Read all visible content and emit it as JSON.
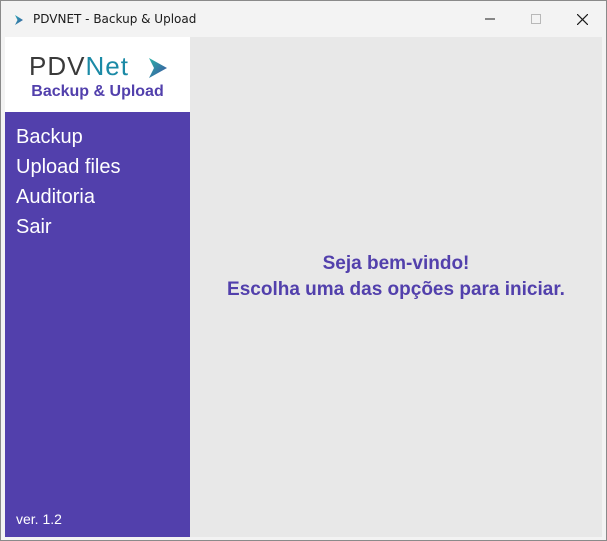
{
  "window": {
    "title": "PDVNET - Backup & Upload",
    "icon": "pdvnet-arrow-icon",
    "controls": [
      "minimize-icon",
      "maximize-icon",
      "close-icon"
    ]
  },
  "sidebar": {
    "logo": {
      "prefix": "PDV",
      "suffix": "Net",
      "subtitle": "Backup & Upload"
    },
    "items": [
      {
        "label": "Backup"
      },
      {
        "label": "Upload files"
      },
      {
        "label": "Auditoria"
      },
      {
        "label": "Sair"
      }
    ],
    "version": "ver. 1.2"
  },
  "main": {
    "welcome_line1": "Seja bem-vindo!",
    "welcome_line2": "Escolha uma das opções para iniciar."
  },
  "colors": {
    "accent": "#5240ac",
    "logo_teal": "#1b8aa6",
    "content_bg": "#e8e8e8",
    "text_white": "#ffffff"
  }
}
